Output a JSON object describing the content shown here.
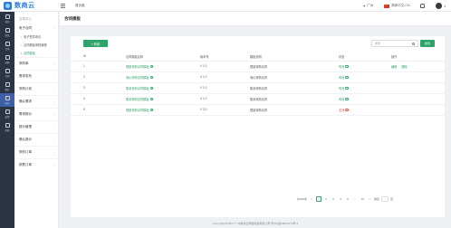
{
  "app": {
    "logo_text": "数商云",
    "home_link": "首页面",
    "location": "广州",
    "language": "简体中文-CN",
    "notification_icon": "bell-icon",
    "user_icon": "user-avatar"
  },
  "iconbar": [
    {
      "label": "首页",
      "icon": "home-icon"
    },
    {
      "label": "商品",
      "icon": "goods-icon"
    },
    {
      "label": "订单",
      "icon": "order-icon"
    },
    {
      "label": "采购",
      "icon": "purchase-icon"
    },
    {
      "label": "合同",
      "icon": "contract-icon"
    },
    {
      "label": "供应",
      "icon": "supply-icon"
    },
    {
      "label": "财务",
      "icon": "finance-icon"
    },
    {
      "label": "设置",
      "icon": "settings-icon"
    },
    {
      "label": "系统",
      "icon": "system-icon"
    }
  ],
  "sidebar": {
    "title": "交易中心",
    "group": "电子合同",
    "subitems": [
      "电子签章申请",
      "合同模板审核管理",
      "合同模板"
    ],
    "items": [
      "采购单",
      "需求发布",
      "采购计划",
      "确认需求",
      "需求报价",
      "报价管理",
      "确认报价",
      "采购订单",
      "销售订单"
    ]
  },
  "page": {
    "title": "合同模板",
    "new_button": "+ 新增",
    "search_placeholder": "搜索",
    "search_button": "搜索"
  },
  "table": {
    "headers": [
      "ID",
      "合同模板名称",
      "版本号",
      "模板说明",
      "状态",
      "操作"
    ],
    "rows": [
      {
        "id": "1",
        "name": "框架采购合同模板",
        "version": "V 1.0",
        "desc": "框架采购合同",
        "status": "有效",
        "status_type": "ok"
      },
      {
        "id": "2",
        "name": "询价采购合同模板",
        "version": "V 1.0",
        "desc": "询价采购合同",
        "status": "有效",
        "status_type": "ok"
      },
      {
        "id": "3",
        "name": "集采采购合同模板",
        "version": "V 1.0",
        "desc": "集采采购合同",
        "status": "有效",
        "status_type": "ok"
      },
      {
        "id": "4",
        "name": "集采采购合同模板",
        "version": "V 1.0",
        "desc": "集采采购合同",
        "status": "有效",
        "status_type": "ok"
      },
      {
        "id": "5",
        "name": "框架采购合同模板",
        "version": "V 2.0",
        "desc": "框架采购合同",
        "status": "无效",
        "status_type": "bad"
      }
    ],
    "op_edit": "编辑",
    "op_delete": "删除"
  },
  "pager": {
    "total": "共400条",
    "prev": "<",
    "pages": [
      "1",
      "2",
      "3",
      "4",
      "5",
      "...",
      "10"
    ],
    "next": ">",
    "goto": "前往",
    "page_suffix": "页"
  },
  "footer": "Copy Right©2017 广州数商云网络科技有限公司 粤ICP备18047674号-3",
  "watermark": "数商云",
  "colors": {
    "accent": "#2fa36b",
    "sidebar_dark": "#2b3445",
    "active_icon": "#3d5fa8",
    "invalid": "#e24b3b"
  }
}
